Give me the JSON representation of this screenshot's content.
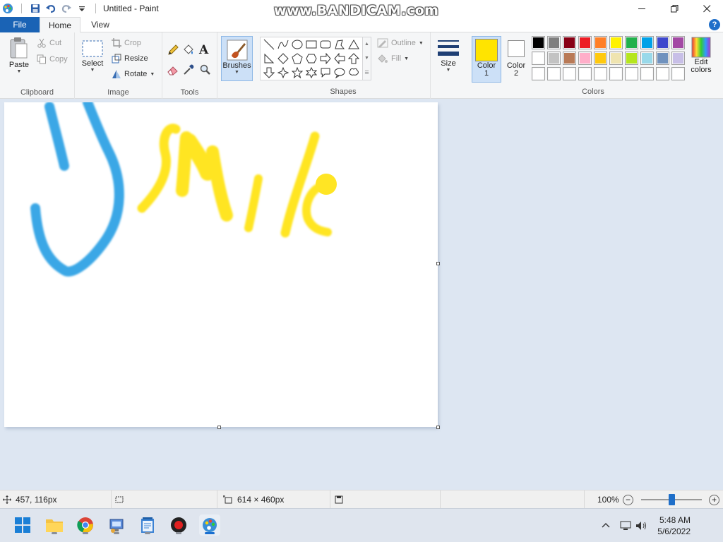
{
  "window": {
    "title": "Untitled - Paint",
    "watermark": "www.BANDICAM.com"
  },
  "tabs": {
    "file": "File",
    "home": "Home",
    "view": "View"
  },
  "help_label": "?",
  "ribbon": {
    "clipboard": {
      "group_label": "Clipboard",
      "paste": "Paste",
      "cut": "Cut",
      "copy": "Copy"
    },
    "image": {
      "group_label": "Image",
      "select": "Select",
      "crop": "Crop",
      "resize": "Resize",
      "rotate": "Rotate"
    },
    "tools": {
      "group_label": "Tools",
      "text_tool_glyph": "A"
    },
    "brushes": {
      "label": "Brushes"
    },
    "shapes": {
      "group_label": "Shapes",
      "outline": "Outline",
      "fill": "Fill"
    },
    "size": {
      "label": "Size"
    },
    "color1": {
      "label_line1": "Color",
      "label_line2": "1",
      "value": "#ffe400"
    },
    "color2": {
      "label_line1": "Color",
      "label_line2": "2",
      "value": "#ffffff"
    },
    "colors": {
      "group_label": "Colors",
      "palette_row1": [
        "#000000",
        "#7f7f7f",
        "#880015",
        "#ed1c24",
        "#ff7f27",
        "#fff200",
        "#22b14c",
        "#00a2e8",
        "#3f48cc",
        "#a349a4"
      ],
      "palette_row2": [
        "#ffffff",
        "#c3c3c3",
        "#b97a57",
        "#ffaec9",
        "#ffc90e",
        "#efe4b0",
        "#b5e61d",
        "#99d9ea",
        "#7092be",
        "#c8bfe7"
      ],
      "palette_row3": [
        "#ffffff",
        "#ffffff",
        "#ffffff",
        "#ffffff",
        "#ffffff",
        "#ffffff",
        "#ffffff",
        "#ffffff",
        "#ffffff",
        "#ffffff"
      ],
      "edit_line1": "Edit",
      "edit_line2": "colors"
    }
  },
  "status": {
    "cursor_position": "457, 116px",
    "canvas_size": "614 × 460px",
    "zoom": "100%",
    "zoom_fraction": 0.5
  },
  "taskbar": {
    "time": "5:48 AM",
    "date": "5/6/2022"
  },
  "colors": {
    "stroke_blue": "#3aa7e6",
    "stroke_yellow": "#ffe524"
  }
}
